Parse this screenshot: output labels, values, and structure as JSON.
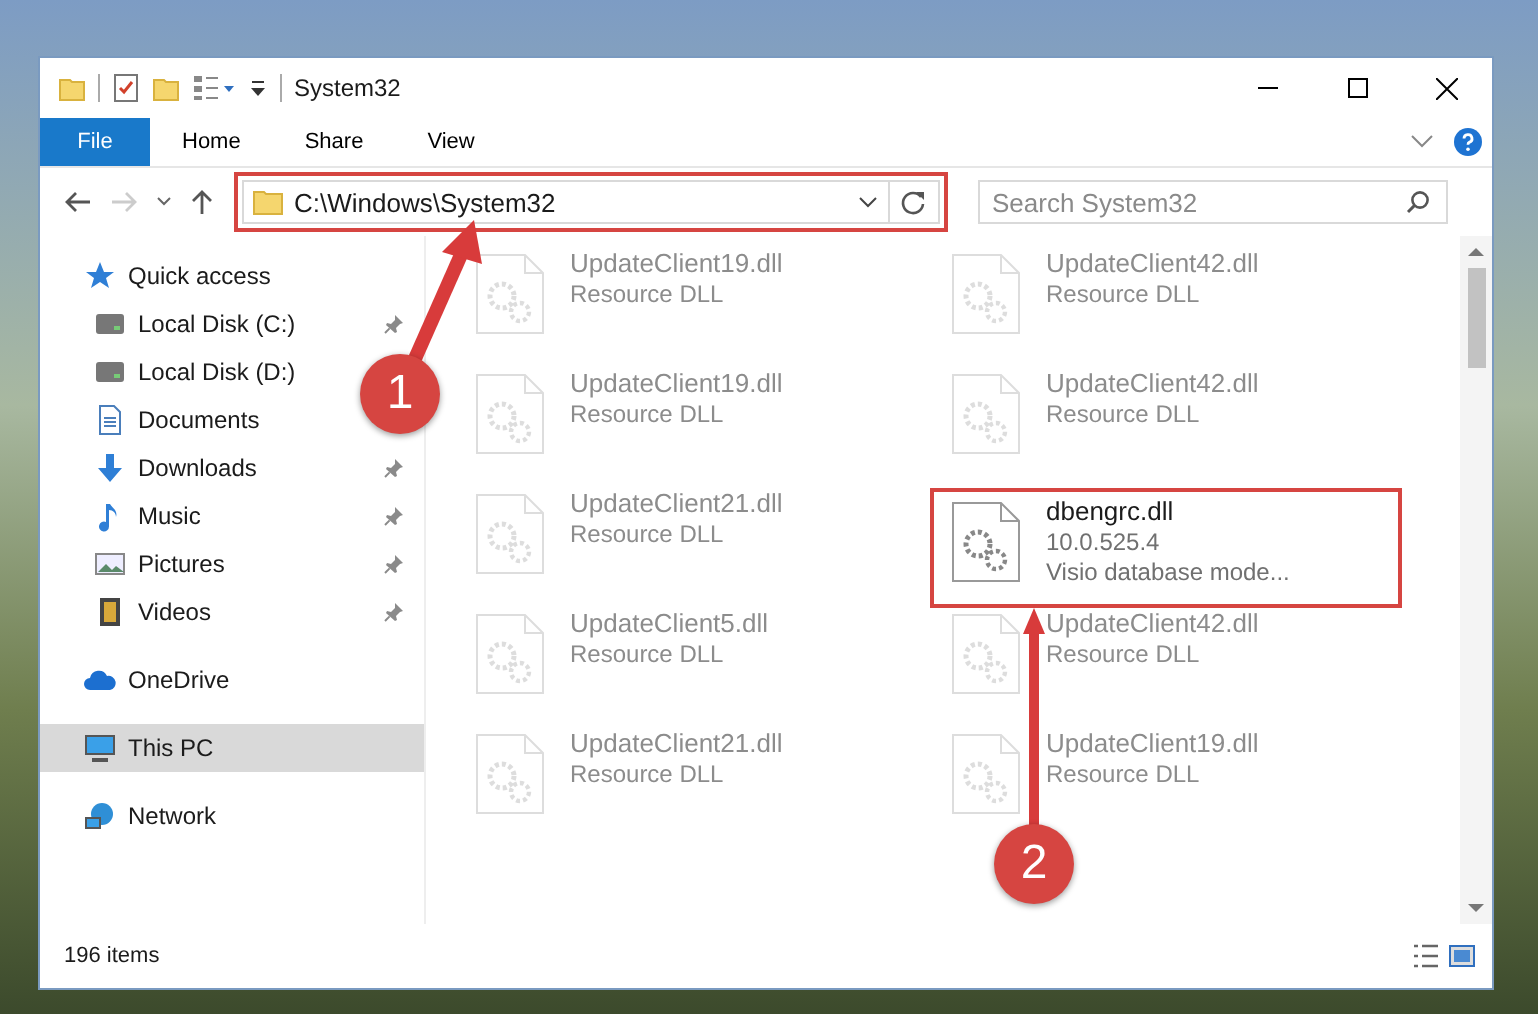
{
  "window": {
    "title": "System32"
  },
  "ribbon_tabs": [
    {
      "label": "File",
      "kind": "file"
    },
    {
      "label": "Home",
      "kind": "tab"
    },
    {
      "label": "Share",
      "kind": "tab"
    },
    {
      "label": "View",
      "kind": "tab"
    }
  ],
  "address_bar": {
    "path": "C:\\Windows\\System32",
    "highlighted": true
  },
  "search": {
    "placeholder": "Search System32"
  },
  "sidebar": {
    "items": [
      {
        "label": "Quick access",
        "kind": "star",
        "selected": false,
        "children": [
          {
            "label": "Local Disk (C:)",
            "kind": "drive",
            "pinned": true
          },
          {
            "label": "Local Disk (D:)",
            "kind": "drive",
            "pinned": false
          },
          {
            "label": "Documents",
            "kind": "document",
            "pinned": false
          },
          {
            "label": "Downloads",
            "kind": "download",
            "pinned": true
          },
          {
            "label": "Music",
            "kind": "music",
            "pinned": true
          },
          {
            "label": "Pictures",
            "kind": "picture",
            "pinned": true
          },
          {
            "label": "Videos",
            "kind": "video",
            "pinned": true
          }
        ]
      },
      {
        "label": "OneDrive",
        "kind": "cloud",
        "selected": false
      },
      {
        "label": "This PC",
        "kind": "computer",
        "selected": true
      },
      {
        "label": "Network",
        "kind": "network",
        "selected": false
      }
    ]
  },
  "files": [
    {
      "name": "UpdateClient19.dll",
      "lines": [
        "Resource DLL"
      ],
      "blurred": true
    },
    {
      "name": "UpdateClient42.dll",
      "lines": [
        "Resource DLL"
      ],
      "blurred": true
    },
    {
      "name": "UpdateClient19.dll",
      "lines": [
        "Resource DLL"
      ],
      "blurred": true
    },
    {
      "name": "UpdateClient42.dll",
      "lines": [
        "Resource DLL"
      ],
      "blurred": true
    },
    {
      "name": "UpdateClient21.dll",
      "lines": [
        "Resource DLL"
      ],
      "blurred": true
    },
    {
      "name": "dbengrc.dll",
      "lines": [
        "10.0.525.4",
        "Visio database mode..."
      ],
      "blurred": false,
      "highlighted": true
    },
    {
      "name": "UpdateClient5.dll",
      "lines": [
        "Resource DLL"
      ],
      "blurred": true
    },
    {
      "name": "UpdateClient42.dll",
      "lines": [
        "Resource DLL"
      ],
      "blurred": true
    },
    {
      "name": "UpdateClient21.dll",
      "lines": [
        "Resource DLL"
      ],
      "blurred": true
    },
    {
      "name": "UpdateClient19.dll",
      "lines": [
        "Resource DLL"
      ],
      "blurred": true
    }
  ],
  "status_bar": {
    "count": "196 items"
  },
  "annotations": [
    {
      "label": "1"
    },
    {
      "label": "2"
    }
  ]
}
